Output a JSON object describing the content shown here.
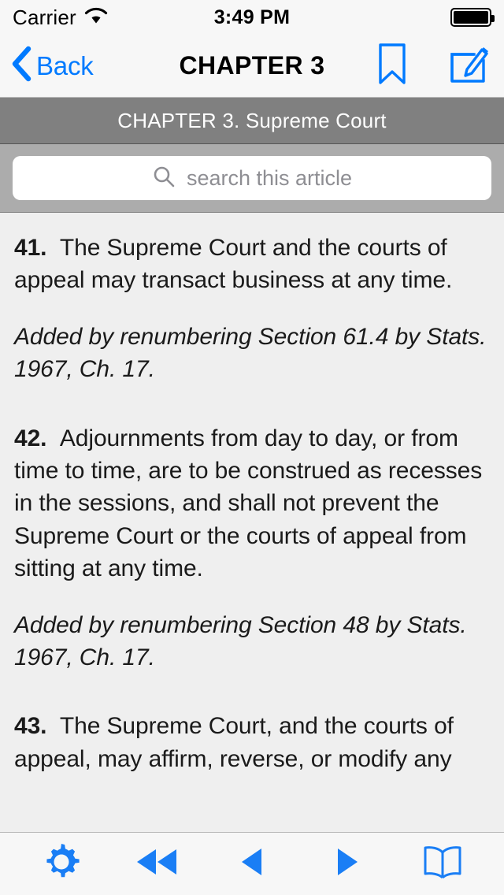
{
  "status_bar": {
    "carrier": "Carrier",
    "wifi_icon": "wifi-icon",
    "time": "3:49 PM",
    "battery_icon": "battery-full-icon"
  },
  "nav_bar": {
    "back_label": "Back",
    "back_icon": "chevron-left-icon",
    "title": "CHAPTER 3",
    "bookmark_icon": "bookmark-icon",
    "compose_icon": "compose-icon"
  },
  "chapter_header": {
    "title": "CHAPTER 3. Supreme Court"
  },
  "search": {
    "icon": "search-icon",
    "placeholder": "search this article",
    "value": ""
  },
  "content": {
    "sections": [
      {
        "number": "41.",
        "body": "The Supreme Court and the courts of appeal may transact business at any time.",
        "citation": "Added by renumbering Section 61.4 by Stats. 1967, Ch. 17."
      },
      {
        "number": "42.",
        "body": "Adjournments from day to day, or from time to time, are to be construed as recesses in the sessions, and shall not prevent the Supreme Court or the courts of appeal from sitting at any time.",
        "citation": "Added by renumbering Section 48 by Stats. 1967, Ch. 17."
      },
      {
        "number": "43.",
        "body": "The Supreme Court, and the courts of appeal, may affirm, reverse, or modify any",
        "citation": ""
      }
    ]
  },
  "toolbar": {
    "buttons": [
      {
        "name": "settings-button",
        "icon": "gear-icon"
      },
      {
        "name": "rewind-button",
        "icon": "rewind-icon"
      },
      {
        "name": "previous-button",
        "icon": "triangle-left-icon"
      },
      {
        "name": "next-button",
        "icon": "triangle-right-icon"
      },
      {
        "name": "library-button",
        "icon": "open-book-icon"
      }
    ]
  },
  "colors": {
    "accent": "#007aff",
    "bar_background": "#f7f7f7",
    "chapter_header_bg": "#808080",
    "search_bar_bg": "#acacac",
    "content_bg": "#efefef",
    "text": "#1a1a1a",
    "placeholder": "#8e8e93"
  }
}
